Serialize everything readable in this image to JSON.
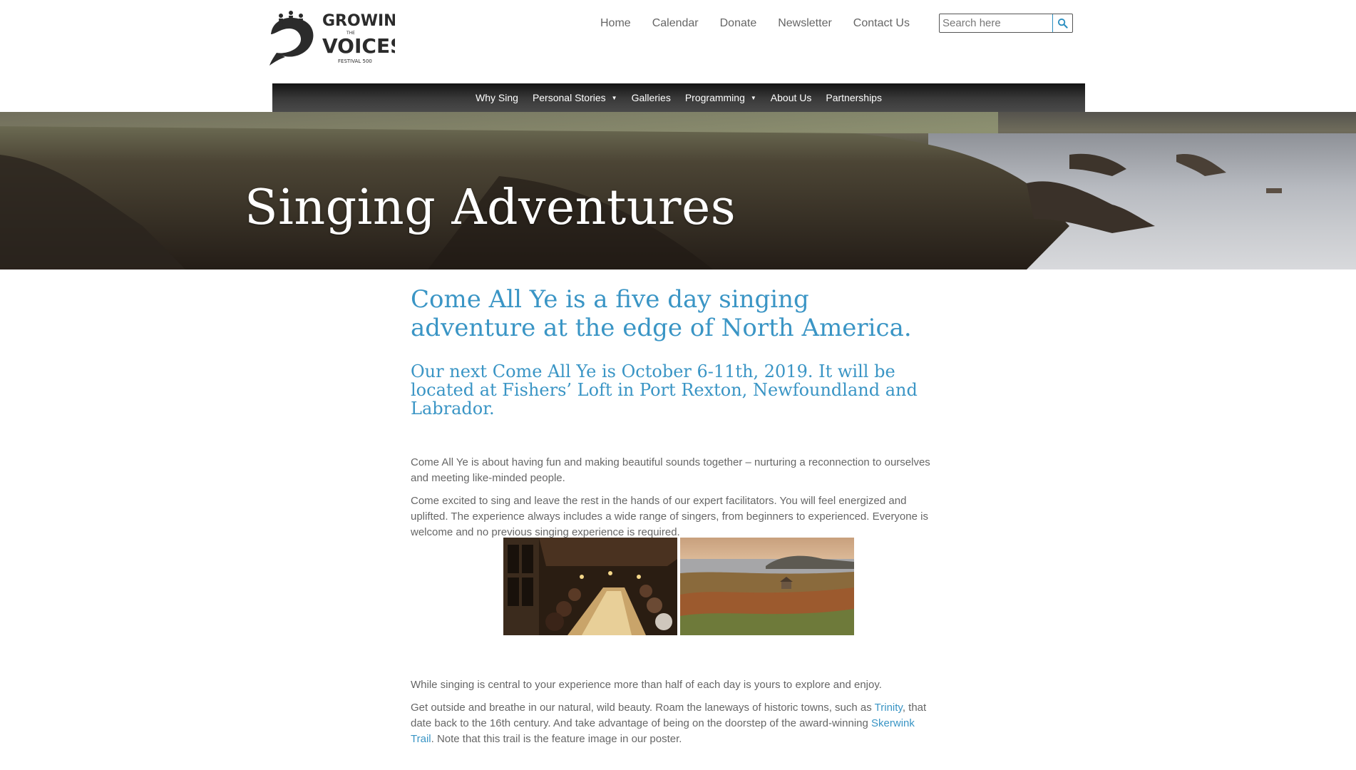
{
  "header": {
    "logo": {
      "line1": "GROWING",
      "line2": "THE",
      "line3": "VOICES",
      "line4": "FESTIVAL 500"
    },
    "nav": [
      "Home",
      "Calendar",
      "Donate",
      "Newsletter",
      "Contact Us"
    ],
    "search": {
      "placeholder": "Search here",
      "icon": "search-icon"
    }
  },
  "mainnav": {
    "items": [
      {
        "label": "Why Sing",
        "dropdown": false
      },
      {
        "label": "Personal Stories",
        "dropdown": true
      },
      {
        "label": "Galleries",
        "dropdown": false
      },
      {
        "label": "Programming",
        "dropdown": true
      },
      {
        "label": "About Us",
        "dropdown": false
      },
      {
        "label": "Partnerships",
        "dropdown": false
      }
    ],
    "caret": "▼"
  },
  "hero": {
    "title": "Singing Adventures"
  },
  "content": {
    "headline": "Come All Ye is a five day singing adventure at the edge of North America.",
    "subheadline": "Our next Come All Ye is October 6-11th, 2019. It will be located at Fishers’ Loft in Port Rexton, Newfoundland and Labrador.",
    "para1": "Come All Ye is about having fun and making beautiful sounds together – nurturing a reconnection to ourselves and meeting like-minded people.",
    "para2": "Come excited to sing and leave the rest in the hands of our expert facilitators. You will feel energized and uplifted. The experience always includes a wide range of singers, from beginners to experienced. Everyone is welcome and no previous singing experience is required.",
    "para3": "While singing is central to your experience more than half of each day is yours to explore and enjoy.",
    "para4": {
      "before_link1": "Get outside and breathe in our natural, wild beauty. Roam the laneways of historic towns, such as ",
      "link1": "Trinity",
      "between": ", that date back to the 16th century. And take advantage of being on the doorstep of the award-winning ",
      "link2": "Skerwink Trail",
      "after_link2": ". Note that this trail is the feature image in our poster."
    }
  },
  "colors": {
    "accent": "#3a95c5",
    "nav_bg": "#2e2e2e",
    "text": "#666666"
  }
}
